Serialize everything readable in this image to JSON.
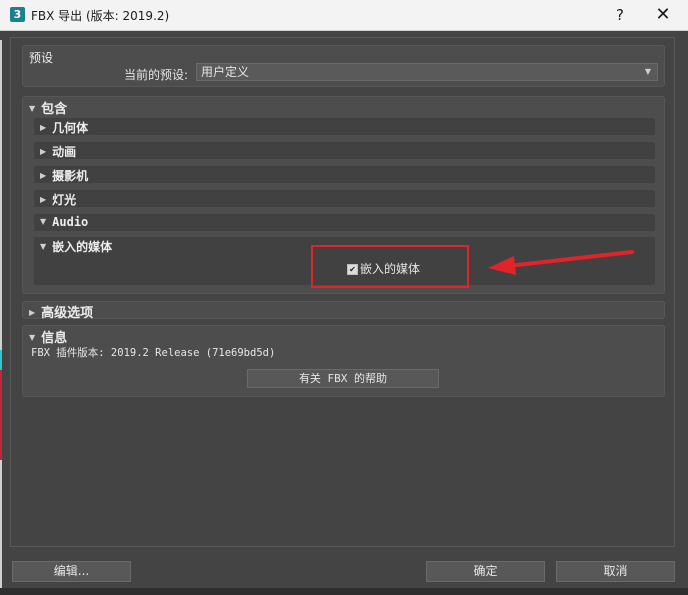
{
  "window": {
    "title": "FBX 导出 (版本: 2019.2)",
    "app_icon": "3",
    "help_label": "?",
    "close_label": "✕"
  },
  "preset": {
    "header": "预设",
    "current_label": "当前的预设:",
    "current_value": "用户定义"
  },
  "include": {
    "header": "包含",
    "items": [
      {
        "label": "几何体",
        "expanded": false
      },
      {
        "label": "动画",
        "expanded": false
      },
      {
        "label": "摄影机",
        "expanded": false
      },
      {
        "label": "灯光",
        "expanded": false
      },
      {
        "label": "Audio",
        "expanded": true
      }
    ],
    "embed_media": {
      "header": "嵌入的媒体",
      "checkbox_label": "嵌入的媒体",
      "checked": true
    }
  },
  "advanced": {
    "header": "高级选项"
  },
  "info": {
    "header": "信息",
    "version_text": "FBX 插件版本: 2019.2 Release (71e69bd5d)",
    "help_button": "有关 FBX 的帮助"
  },
  "footer": {
    "edit_button": "编辑...",
    "ok_button": "确定",
    "cancel_button": "取消"
  },
  "colors": {
    "annotation": "#e0242a",
    "background": "#444444",
    "panel": "#4d4d4d"
  },
  "icons": {
    "collapsed": "caret-right-icon",
    "expanded": "caret-down-icon"
  }
}
